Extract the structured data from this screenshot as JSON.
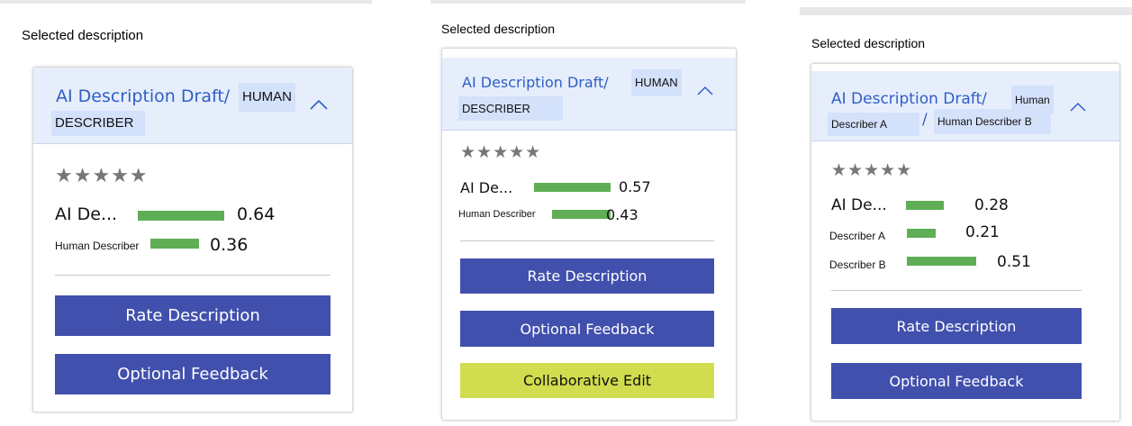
{
  "colors": {
    "bar": "#5fae55",
    "button": "#4150ad",
    "collab_button": "#d1dc4e",
    "header_bg": "#e6eefc",
    "title_blue": "#2f5ec6"
  },
  "panels": [
    {
      "caption": "Selected description",
      "title_ai": "AI Description Draft/",
      "tags": [
        "HUMAN",
        "DESCRIBER"
      ],
      "separator": "",
      "stars": "★★★★★",
      "rows": [
        {
          "label": "AI De...",
          "value": 0.64,
          "value_text": "0.64"
        },
        {
          "label": "Human Describer",
          "value": 0.36,
          "value_text": "0.36"
        }
      ],
      "buttons": [
        "Rate Description",
        "Optional Feedback"
      ],
      "chevron_icon": "chevron-up-icon"
    },
    {
      "caption": "Selected description",
      "title_ai": "AI Description Draft/",
      "tags": [
        "HUMAN",
        "DESCRIBER"
      ],
      "separator": "",
      "stars": "★★★★★",
      "rows": [
        {
          "label": "AI De...",
          "value": 0.57,
          "value_text": "0.57"
        },
        {
          "label": "Human Describer",
          "value": 0.43,
          "value_text": "0.43"
        }
      ],
      "buttons": [
        "Rate Description",
        "Optional Feedback",
        "Collaborative Edit"
      ],
      "chevron_icon": "chevron-up-icon"
    },
    {
      "caption": "Selected description",
      "title_ai": "AI Description Draft/",
      "tags": [
        "Human",
        "Describer A",
        "Human Describer B"
      ],
      "separator": "/",
      "stars": "★★★★★",
      "rows": [
        {
          "label": "AI De...",
          "value": 0.28,
          "value_text": "0.28"
        },
        {
          "label": "Describer A",
          "value": 0.21,
          "value_text": "0.21"
        },
        {
          "label": "Describer B",
          "value": 0.51,
          "value_text": "0.51"
        }
      ],
      "buttons": [
        "Rate Description",
        "Optional Feedback"
      ],
      "chevron_icon": "chevron-up-icon"
    }
  ]
}
